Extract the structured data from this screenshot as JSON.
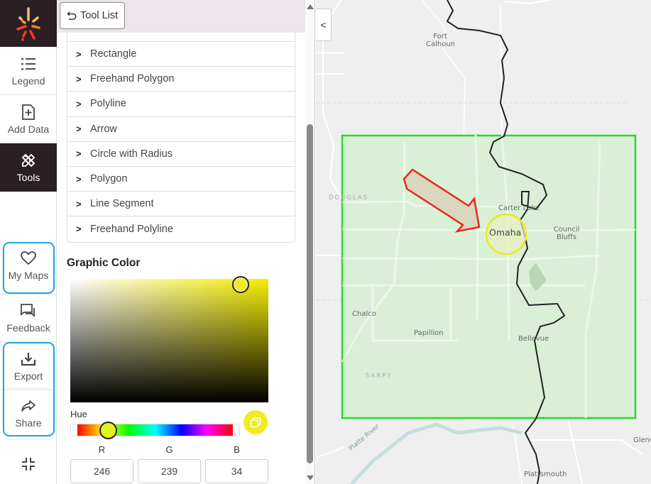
{
  "nav": {
    "logo": "app-logo",
    "items": [
      {
        "label": "Legend",
        "icon": "list-icon",
        "active": false
      },
      {
        "label": "Add Data",
        "icon": "add-file-icon",
        "active": false
      },
      {
        "label": "Tools",
        "icon": "tools-icon",
        "active": true
      },
      {
        "label": "My Maps",
        "icon": "heart-icon",
        "active": false
      },
      {
        "label": "Feedback",
        "icon": "feedback-icon",
        "active": false
      },
      {
        "label": "Export",
        "icon": "download-icon",
        "active": false
      },
      {
        "label": "Share",
        "icon": "share-icon",
        "active": false
      }
    ],
    "collapse_icon": "minimize-icon",
    "highlight_color": "#1aa6e0"
  },
  "panel": {
    "back_button": "Tool List",
    "tools": [
      "Rectangle",
      "Freehand Polygon",
      "Polyline",
      "Arrow",
      "Circle with Radius",
      "Polygon",
      "Line Segment",
      "Freehand Polyline"
    ],
    "graphic_color": {
      "title": "Graphic Color",
      "hue_label": "Hue",
      "selected_hex": "#F6EF22",
      "rgb": {
        "labels": [
          "R",
          "G",
          "B"
        ],
        "values": [
          "246",
          "239",
          "34"
        ]
      }
    }
  },
  "map": {
    "collapse_label": "<",
    "labels": {
      "fort_calhoun": "Fort\nCalhoun",
      "douglas": "DOUGLAS",
      "carter_lake": "Carter Lake",
      "omaha": "Omaha",
      "council_bluffs": "Council\nBluffs",
      "chalco": "Chalco",
      "papillion": "Papillion",
      "bellevue": "Bellevue",
      "sarpy": "SARPY",
      "platte_river": "Platte River",
      "glenwood": "Glenw",
      "plattsmouth": "Plattsmouth"
    },
    "graphics": {
      "rectangle_color": "#22dd22",
      "arrow_color": "#e8281e",
      "circle_color": "#f0e61e"
    }
  }
}
